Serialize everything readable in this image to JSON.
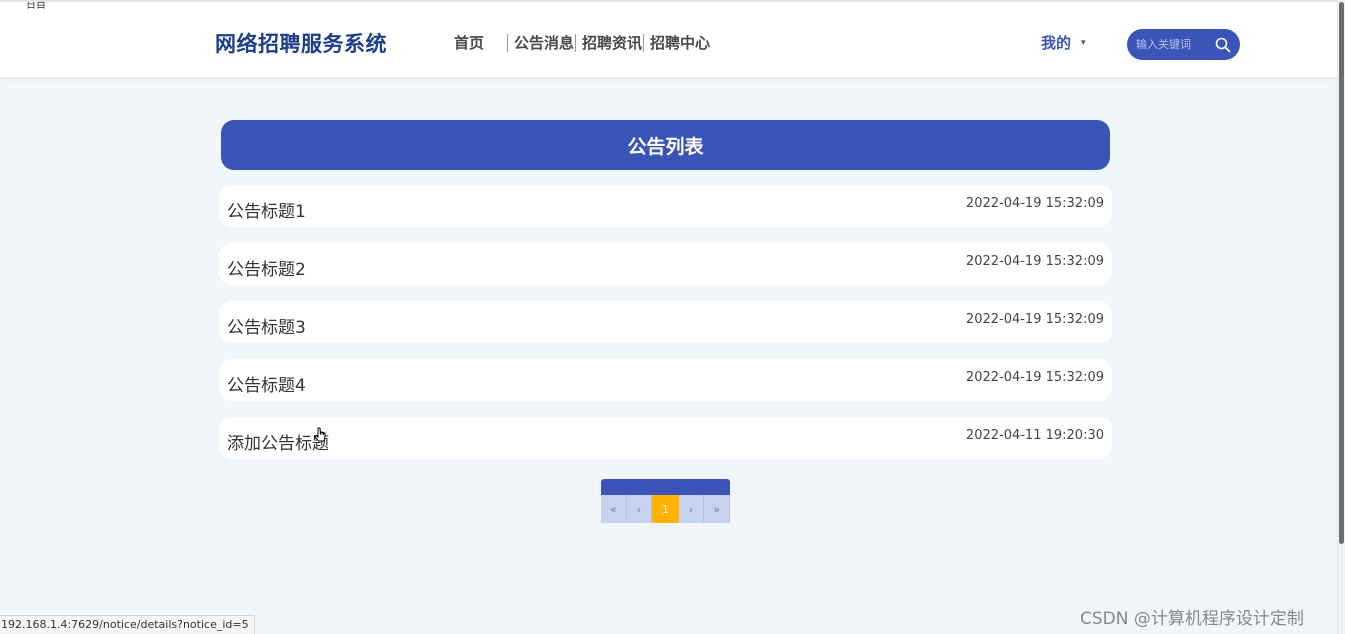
{
  "header": {
    "corner_text": "日目",
    "logo": "网络招聘服务系统",
    "nav": [
      {
        "label": "首页"
      },
      {
        "label": "公告消息"
      },
      {
        "label": "招聘资讯"
      },
      {
        "label": "招聘中心"
      }
    ],
    "mine_label": "我的",
    "mine_caret": "▾",
    "search_placeholder": "输入关键词"
  },
  "main": {
    "banner_title": "公告列表",
    "items": [
      {
        "title": "公告标题1",
        "time": "2022-04-19 15:32:09"
      },
      {
        "title": "公告标题2",
        "time": "2022-04-19 15:32:09"
      },
      {
        "title": "公告标题3",
        "time": "2022-04-19 15:32:09"
      },
      {
        "title": "公告标题4",
        "time": "2022-04-19 15:32:09"
      },
      {
        "title": "添加公告标题",
        "time": "2022-04-11 19:20:30"
      }
    ],
    "pager": {
      "first": "«",
      "prev": "‹",
      "current": "1",
      "next": "›",
      "last": "»"
    }
  },
  "status_bar": {
    "url": "192.168.1.4:7629/notice/details?notice_id=5"
  },
  "watermark": "CSDN @计算机程序设计定制",
  "colors": {
    "accent": "#3a54b8",
    "logo": "#1c3e8c",
    "page_bg": "#f0f6f9",
    "pager_current": "#ffb300"
  }
}
